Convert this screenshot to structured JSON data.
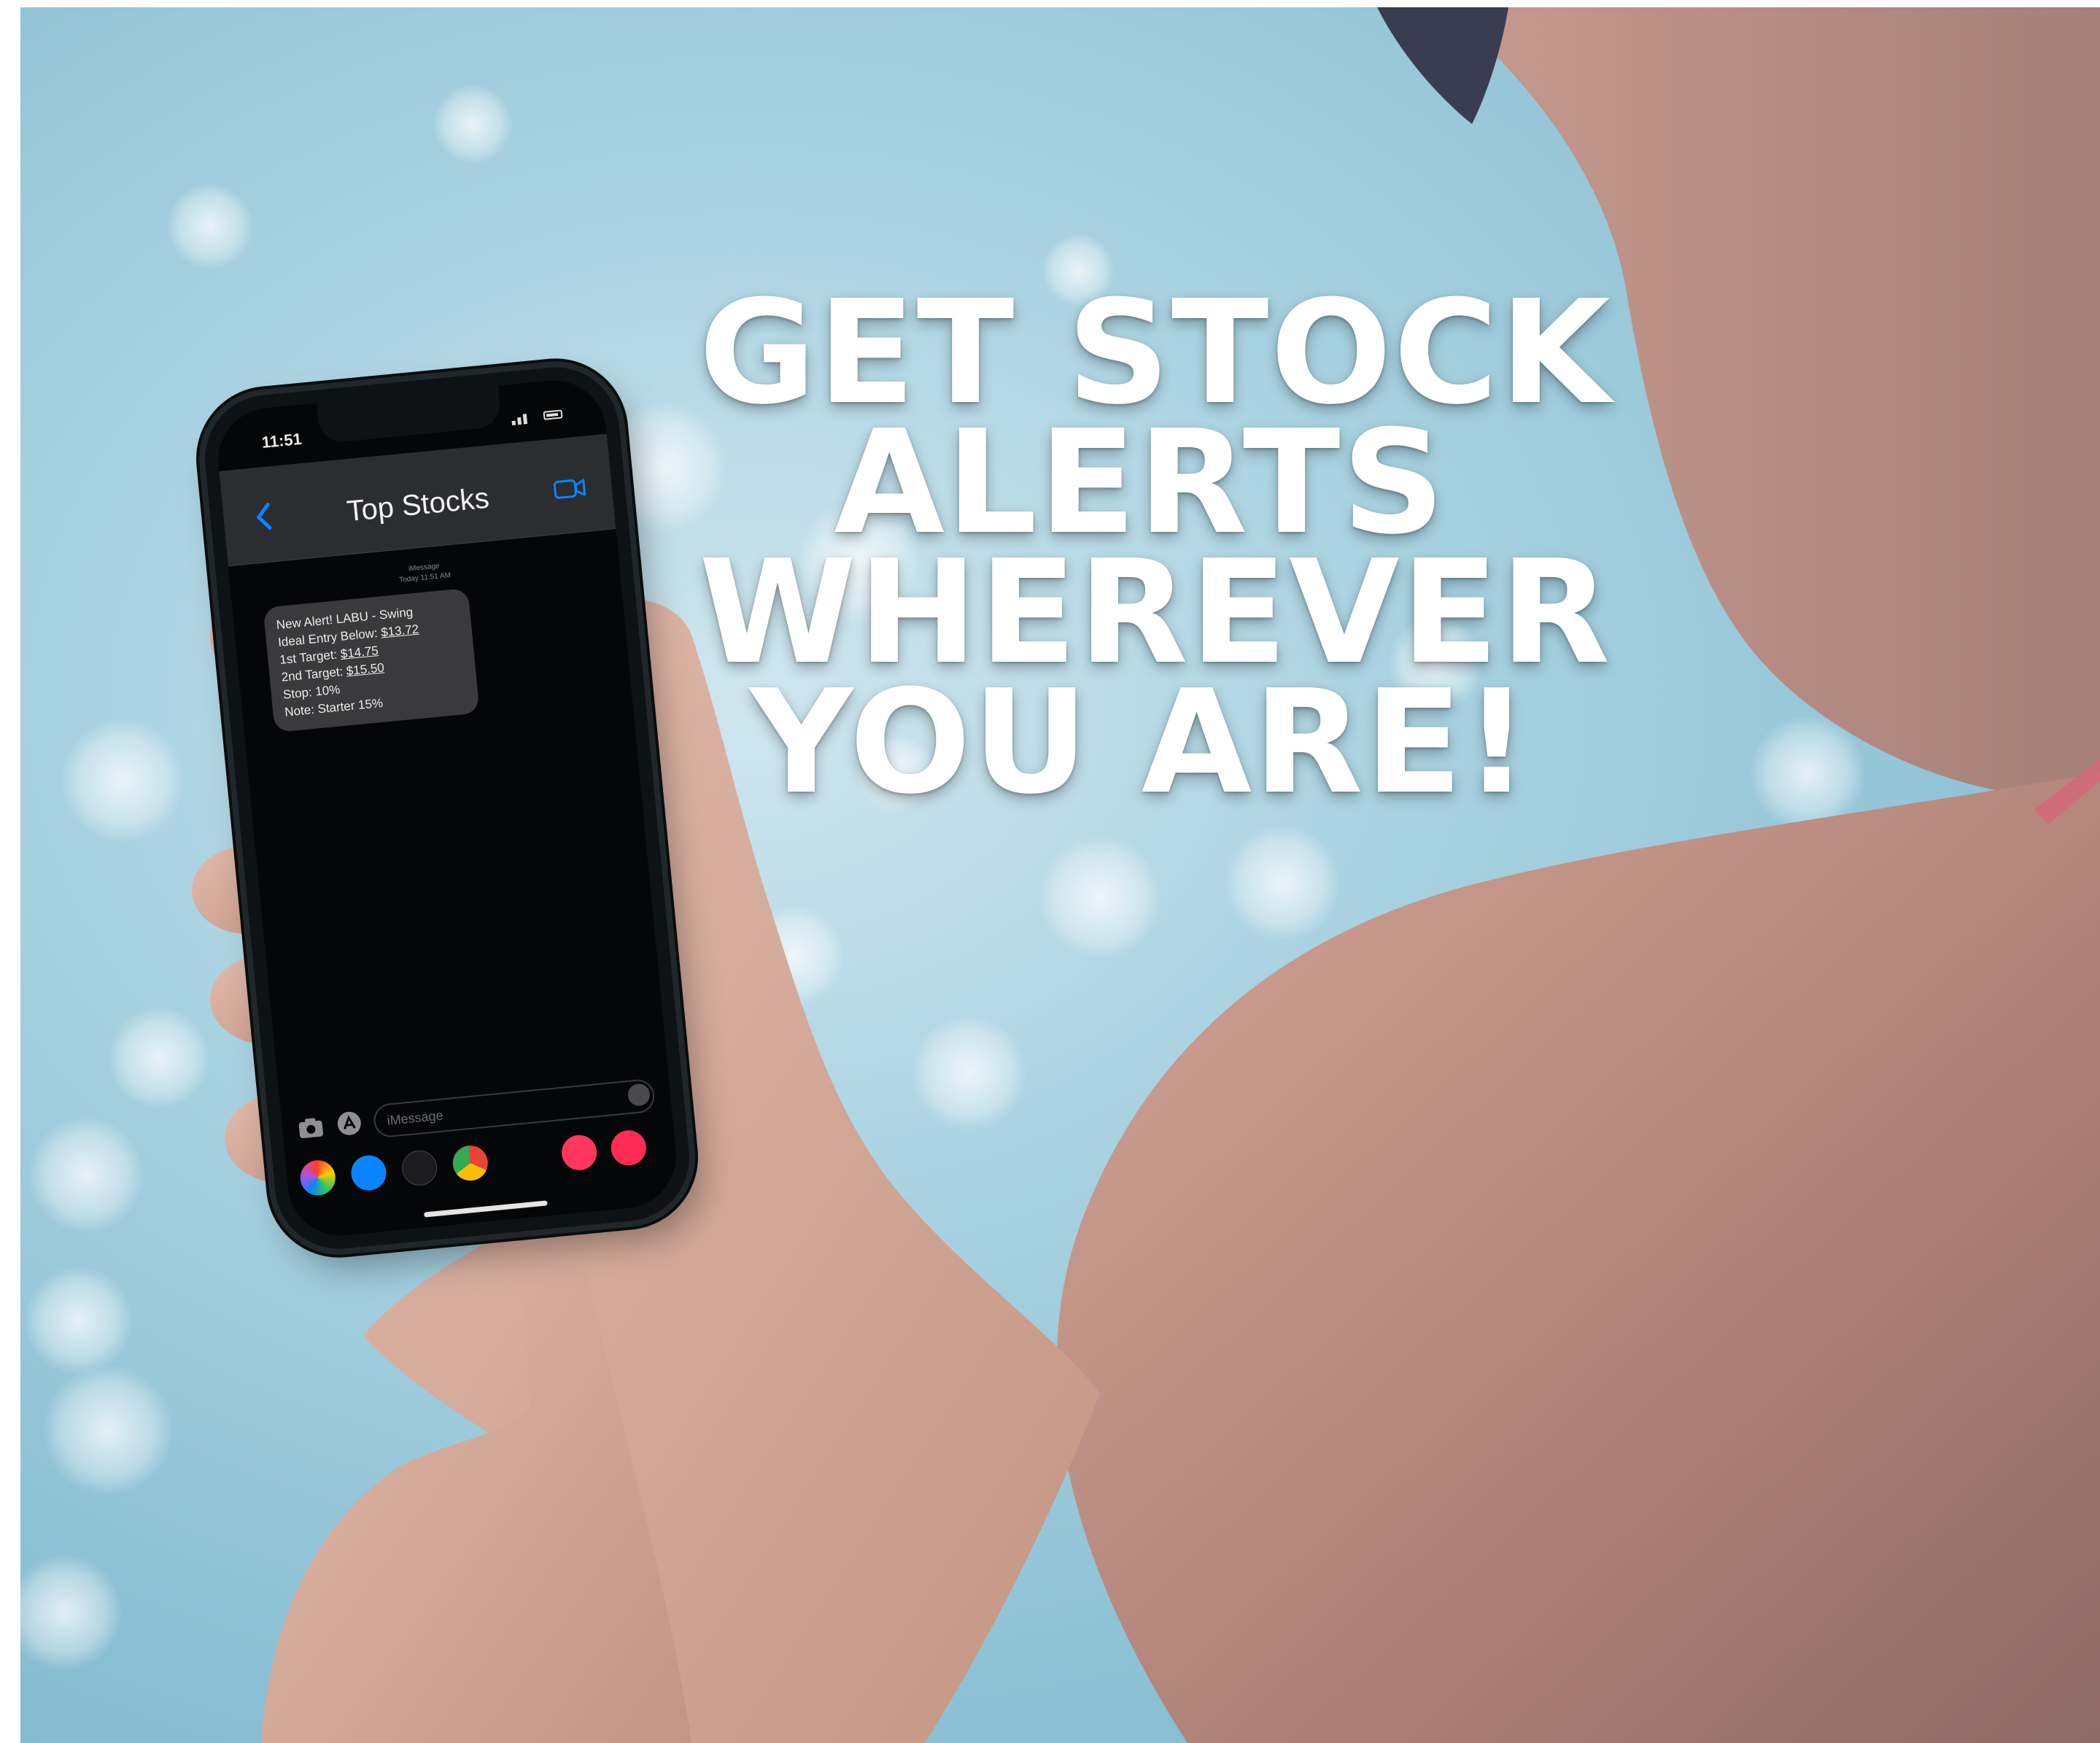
{
  "headline": {
    "line1": "GET STOCK",
    "line2": "ALERTS",
    "line3": "WHEREVER",
    "line4": "YOU ARE!"
  },
  "phone": {
    "status_time": "11:51",
    "nav_title": "Top Stocks",
    "meta_line1": "iMessage",
    "meta_line2": "Today 11:51 AM",
    "alert": {
      "line1": "New Alert! LABU - Swing",
      "entry_label": "Ideal Entry Below: ",
      "entry_value": "$13.72",
      "target1_label": "1st Target: ",
      "target1_value": "$14.75",
      "target2_label": "2nd Target: ",
      "target2_value": "$15.50",
      "stop": "Stop: 10%",
      "note": "Note: Starter 15%"
    },
    "message_placeholder": "iMessage",
    "app_icons": [
      "photos-icon",
      "app-store-icon",
      "apple-pay-icon",
      "chrome-icon",
      "search-app-icon",
      "red-app-icon"
    ]
  },
  "colors": {
    "sky": "#a9d2e1",
    "skin": "#c9998c",
    "headline_text": "#ffffff",
    "ios_blue": "#0a84ff"
  }
}
